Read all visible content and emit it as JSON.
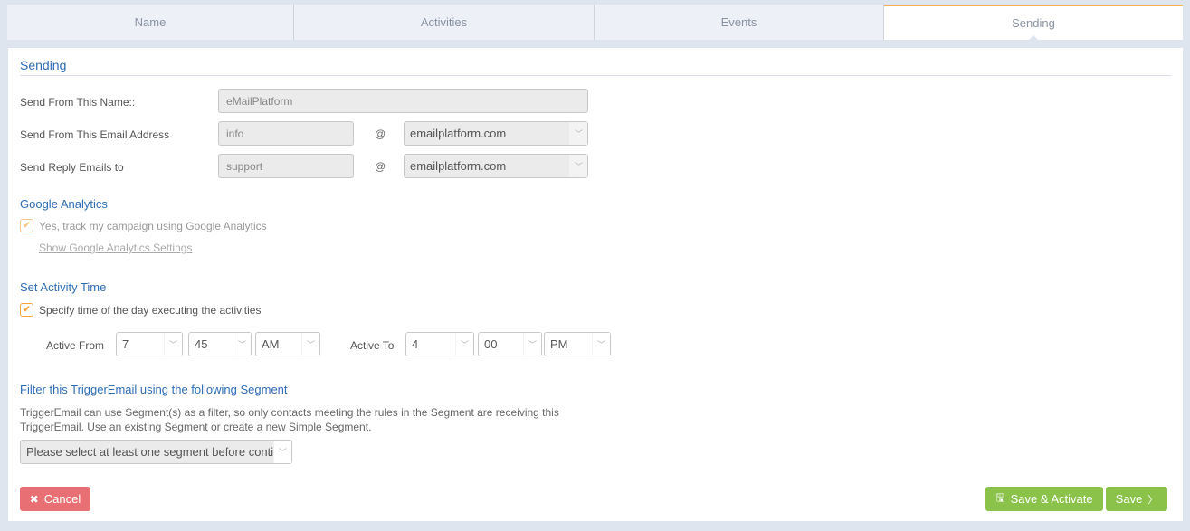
{
  "tabs": [
    {
      "label": "Name",
      "active": false
    },
    {
      "label": "Activities",
      "active": false
    },
    {
      "label": "Events",
      "active": false
    },
    {
      "label": "Sending",
      "active": true
    }
  ],
  "page": {
    "title": "Sending"
  },
  "sender": {
    "from_name_label": "Send From This Name::",
    "from_name_value": "eMailPlatform",
    "from_email_label": "Send From This Email Address",
    "from_email_local": "info",
    "from_email_domain": "emailplatform.com",
    "reply_label": "Send Reply Emails to",
    "reply_local": "support",
    "reply_domain": "emailplatform.com",
    "at_symbol": "@"
  },
  "google_analytics": {
    "title": "Google Analytics",
    "track_label": "Yes, track my campaign using Google Analytics",
    "track_checked": true,
    "settings_link": "Show Google Analytics Settings"
  },
  "activity_time": {
    "title": "Set Activity Time",
    "specify_label": "Specify time of the day executing the activities",
    "specify_checked": true,
    "active_from_label": "Active From",
    "from_hour": "7",
    "from_minute": "45",
    "from_ampm": "AM",
    "active_to_label": "Active To",
    "to_hour": "4",
    "to_minute": "00",
    "to_ampm": "PM"
  },
  "segment": {
    "title": "Filter this TriggerEmail using the following Segment",
    "description": "TriggerEmail can use Segment(s) as a filter, so only contacts meeting the rules in the Segment are receiving this TriggerEmail. Use an existing Segment or create a new Simple Segment.",
    "select_value": "Please select at least one segment before conti"
  },
  "actions": {
    "cancel_label": "Cancel",
    "save_activate_label": "Save & Activate",
    "save_label": "Save"
  },
  "colors": {
    "accent_tab": "#f6b352",
    "title_blue": "#2f6db5",
    "cancel": "#e87074",
    "save": "#8bc34a",
    "checkbox": "#f6a43a"
  },
  "icons": {
    "chevron_down": "﹀",
    "check": "✔",
    "close": "✖",
    "save_disk": "🖫",
    "chevron_right": "〉"
  }
}
